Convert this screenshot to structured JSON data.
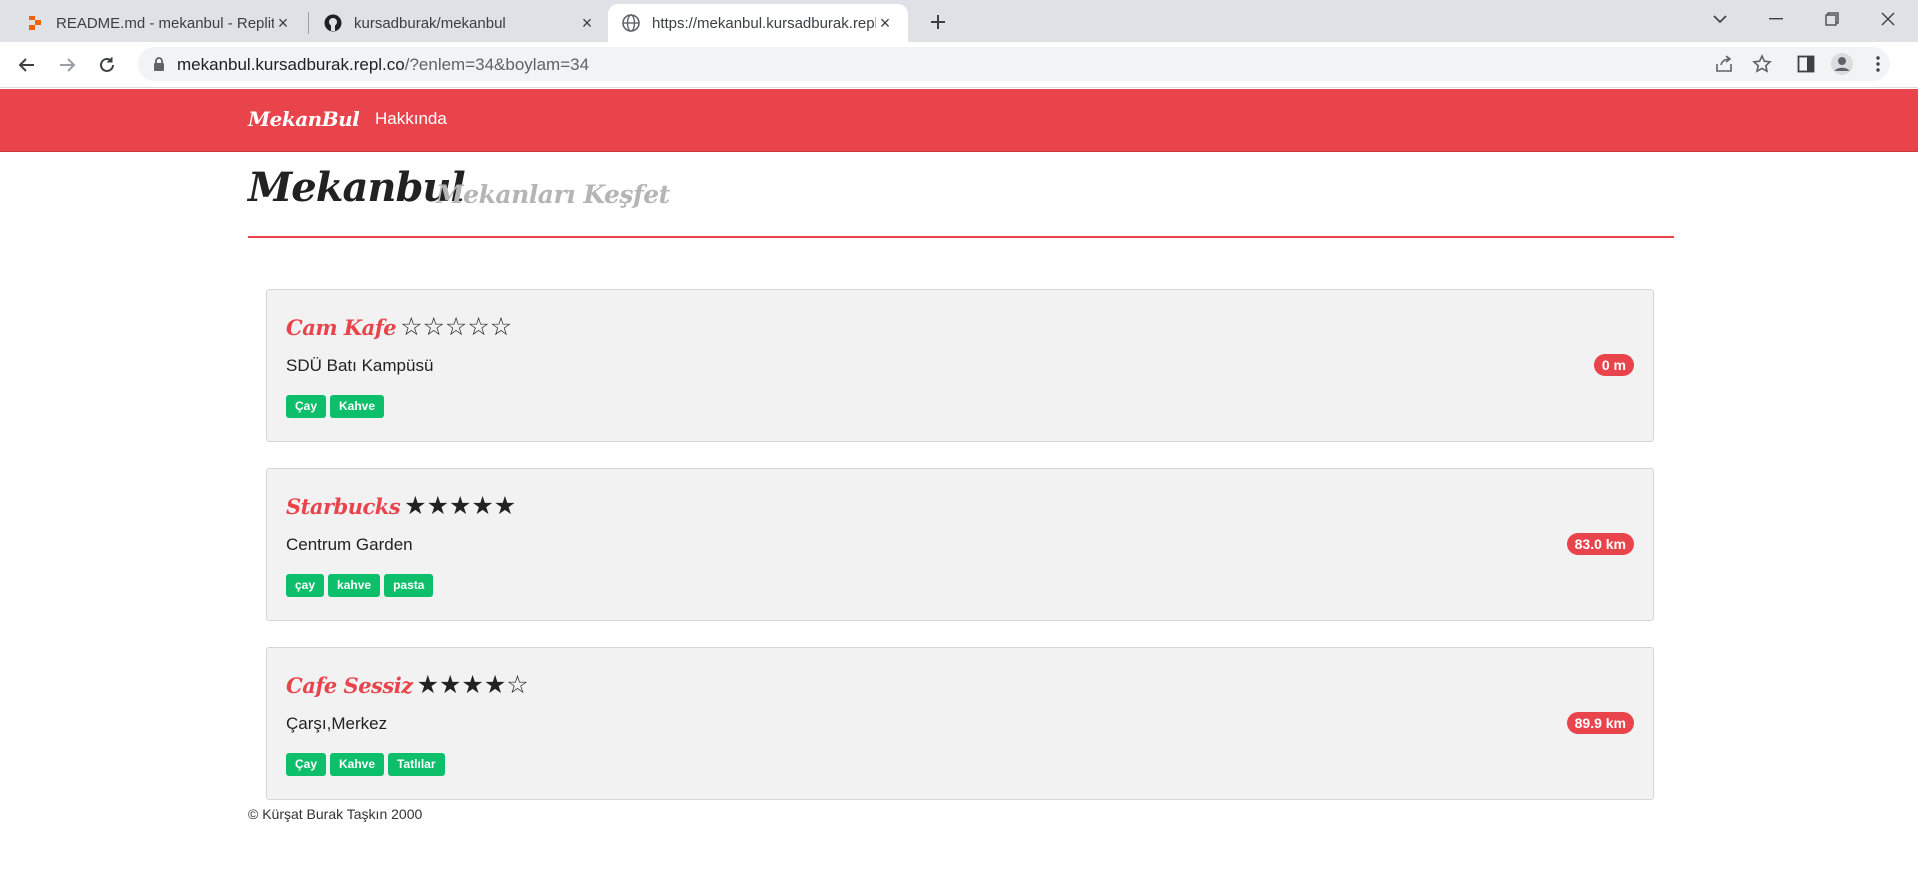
{
  "browser": {
    "tabs": [
      {
        "title": "README.md - mekanbul - Replit",
        "icon": "replit-icon",
        "active": false
      },
      {
        "title": "kursadburak/mekanbul",
        "icon": "github-icon",
        "active": false
      },
      {
        "title": "https://mekanbul.kursadburak.repl.co",
        "icon": "globe-icon",
        "active": true
      }
    ],
    "address": {
      "host": "mekanbul.kursadburak.repl.co",
      "path": "/?enlem=34&boylam=34"
    }
  },
  "site": {
    "brand": "MekanBul",
    "nav_link": "Hakkında",
    "header": {
      "title": "Mekanbul",
      "subtitle": "Mekanları Keşfet"
    },
    "venues": [
      {
        "name": "Cam Kafe",
        "rating": 0,
        "stars": "☆☆☆☆☆",
        "address": "SDÜ Batı Kampüsü",
        "tags": [
          "Çay",
          "Kahve"
        ],
        "distance": "0 m"
      },
      {
        "name": "Starbucks",
        "rating": 5,
        "stars": "★★★★★",
        "address": "Centrum Garden",
        "tags": [
          "çay",
          "kahve",
          "pasta"
        ],
        "distance": "83.0 km"
      },
      {
        "name": "Cafe Sessiz",
        "rating": 4,
        "stars": "★★★★☆",
        "address": "Çarşı,Merkez",
        "tags": [
          "Çay",
          "Kahve",
          "Tatlılar"
        ],
        "distance": "89.9 km"
      }
    ],
    "footer": "© Kürşat Burak Taşkın 2000"
  },
  "colors": {
    "brand_red": "#e9444c",
    "tag_green": "#0dbe6b",
    "card_bg": "#f2f2f2"
  }
}
